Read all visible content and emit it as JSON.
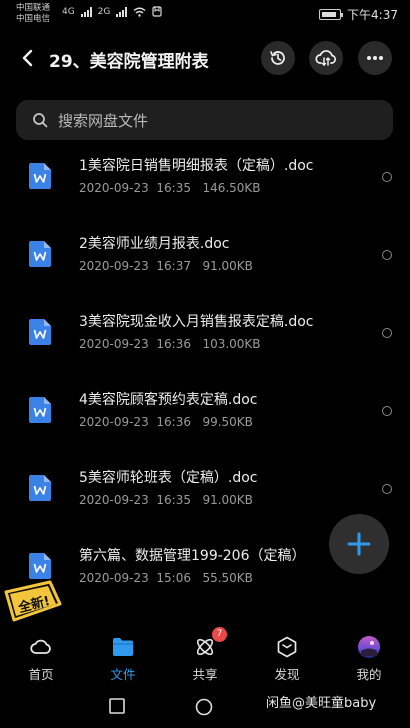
{
  "status_bar": {
    "carrier_1": "中国联通",
    "carrier_2": "中国电信",
    "net_1": "4G",
    "net_2": "2G",
    "time": "下午4:37"
  },
  "header": {
    "title": "29、美容院管理附表",
    "icons": [
      "back-icon",
      "history-icon",
      "cloud-transfer-icon",
      "more-icon"
    ]
  },
  "search": {
    "placeholder": "搜索网盘文件"
  },
  "files": [
    {
      "name": "1美容院日销售明细报表（定稿）.doc",
      "date": "2020-09-23",
      "time": "16:35",
      "size": "146.50KB"
    },
    {
      "name": "2美容师业绩月报表.doc",
      "date": "2020-09-23",
      "time": "16:37",
      "size": "91.00KB"
    },
    {
      "name": "3美容院现金收入月销售报表定稿.doc",
      "date": "2020-09-23",
      "time": "16:36",
      "size": "103.00KB"
    },
    {
      "name": "4美容院顾客预约表定稿.doc",
      "date": "2020-09-23",
      "time": "16:36",
      "size": "99.50KB"
    },
    {
      "name": "5美容师轮班表（定稿）.doc",
      "date": "2020-09-23",
      "time": "16:35",
      "size": "91.00KB"
    },
    {
      "name": "第六篇、数据管理199-206（定稿）",
      "date": "2020-09-23",
      "time": "15:06",
      "size": "55.50KB"
    }
  ],
  "fab": {
    "icon": "plus-icon"
  },
  "sticker": {
    "text": "全新!"
  },
  "nav": {
    "items": [
      {
        "label": "首页",
        "icon": "home-cloud-icon",
        "active": false
      },
      {
        "label": "文件",
        "icon": "folder-icon",
        "active": true
      },
      {
        "label": "共享",
        "icon": "share-atom-icon",
        "active": false,
        "badge": "7"
      },
      {
        "label": "发现",
        "icon": "discover-cube-icon",
        "active": false
      },
      {
        "label": "我的",
        "icon": "avatar-icon",
        "active": false
      }
    ]
  },
  "watermark": "闲鱼@美旺童baby",
  "colors": {
    "accent": "#2f9bf0",
    "doc_icon": "#3b82e6",
    "badge": "#e84a4a",
    "background": "#000000"
  }
}
